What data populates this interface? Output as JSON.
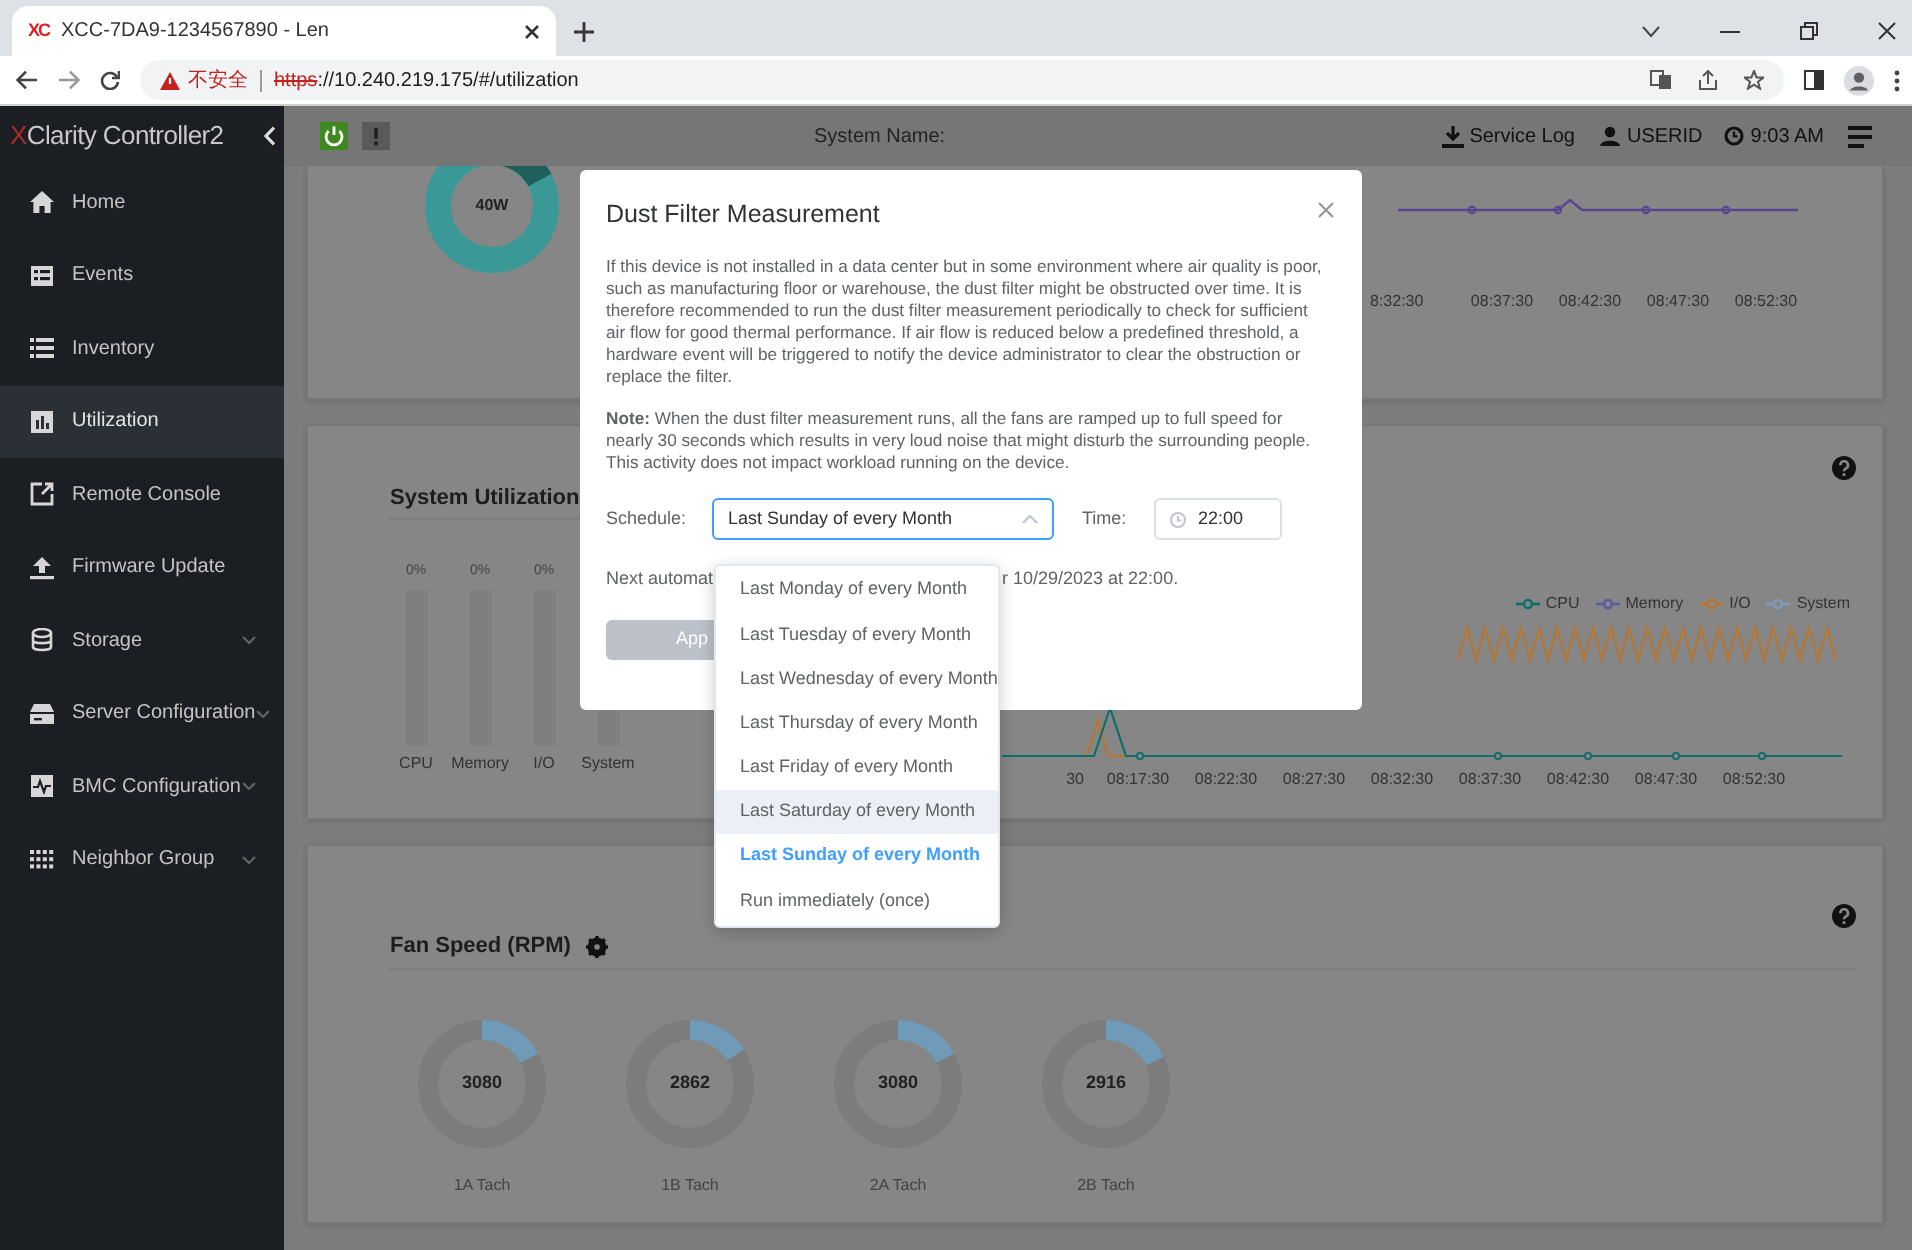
{
  "browser": {
    "favicon": "XC",
    "tab_title": "XCC-7DA9-1234567890 - Len",
    "security": "不安全",
    "url_scheme": "https",
    "url_rest": "://10.240.219.175/#/utilization"
  },
  "header": {
    "brand_mark": "X",
    "brand": "Clarity Controller2",
    "system_name": "System Name:",
    "service_log": "Service Log",
    "user": "USERID",
    "time": "9:03 AM"
  },
  "sidebar": [
    {
      "label": "Home",
      "selected": false,
      "expandable": false
    },
    {
      "label": "Events",
      "selected": false,
      "expandable": false
    },
    {
      "label": "Inventory",
      "selected": false,
      "expandable": false
    },
    {
      "label": "Utilization",
      "selected": true,
      "expandable": false
    },
    {
      "label": "Remote Console",
      "selected": false,
      "expandable": false
    },
    {
      "label": "Firmware Update",
      "selected": false,
      "expandable": false
    },
    {
      "label": "Storage",
      "selected": false,
      "expandable": true
    },
    {
      "label": "Server Configuration",
      "selected": false,
      "expandable": true
    },
    {
      "label": "BMC Configuration",
      "selected": false,
      "expandable": true
    },
    {
      "label": "Neighbor Group",
      "selected": false,
      "expandable": true
    }
  ],
  "power_card": {
    "donut_label": "40W",
    "x_labels": [
      "8:32:30",
      "08:37:30",
      "08:42:30",
      "08:47:30",
      "08:52:30"
    ]
  },
  "utilization_card": {
    "title": "System Utilization",
    "bars": [
      {
        "label": "CPU",
        "reading": "0%"
      },
      {
        "label": "Memory",
        "reading": "0%"
      },
      {
        "label": "I/O",
        "reading": "0%"
      },
      {
        "label": "System"
      }
    ],
    "legend": [
      {
        "label": "CPU",
        "color": "#0f6e6b"
      },
      {
        "label": "Memory",
        "color": "#5b5ba3"
      },
      {
        "label": "I/O",
        "color": "#b8742a"
      },
      {
        "label": "System",
        "color": "#7d9cb8"
      }
    ],
    "x_labels": [
      "30",
      "08:17:30",
      "08:22:30",
      "08:27:30",
      "08:32:30",
      "08:37:30",
      "08:42:30",
      "08:47:30",
      "08:52:30"
    ]
  },
  "fan_card": {
    "title": "Fan Speed (RPM)",
    "fans": [
      {
        "value": "3080",
        "label": "1A Tach",
        "level": 0.17
      },
      {
        "value": "2862",
        "label": "1B Tach",
        "level": 0.16
      },
      {
        "value": "3080",
        "label": "2A Tach",
        "level": 0.17
      },
      {
        "value": "2916",
        "label": "2B Tach",
        "level": 0.18
      }
    ]
  },
  "dialog": {
    "title": "Dust Filter Measurement",
    "description": "If this device is not installed in a data center but in some environment where air quality is poor, such as manufacturing floor or warehouse, the dust filter might be obstructed over time. It is therefore recommended to run the dust filter measurement periodically to check for sufficient air flow for good thermal performance. If air flow is reduced below a predefined threshold, a hardware event will be triggered to notify the device administrator to clear the obstruction or replace the filter.",
    "note": "**Note:** When the dust filter measurement runs, all the fans are ramped up to full speed for nearly 30 seconds which results in very loud noise that might disturb the surrounding people. This activity does not impact workload running on the device.",
    "schedule_label": "Schedule:",
    "schedule_value": "Last Sunday of every Month",
    "time_label": "Time:",
    "time_value": "22:00",
    "next_run_start": "Next automat",
    "next_run_end": "r 10/29/2023 at 22:00.",
    "apply": "App",
    "options": [
      {
        "label": "Last Monday of every Month",
        "selected": false,
        "hovered": false
      },
      {
        "label": "Last Tuesday of every Month",
        "selected": false,
        "hovered": false
      },
      {
        "label": "Last Wednesday of every Month",
        "selected": false,
        "hovered": false
      },
      {
        "label": "Last Thursday of every Month",
        "selected": false,
        "hovered": false
      },
      {
        "label": "Last Friday of every Month",
        "selected": false,
        "hovered": false
      },
      {
        "label": "Last Saturday of every Month",
        "selected": false,
        "hovered": true
      },
      {
        "label": "Last Sunday of every Month",
        "selected": true,
        "hovered": false
      },
      {
        "label": "Run immediately (once)",
        "selected": false,
        "hovered": false
      }
    ]
  }
}
